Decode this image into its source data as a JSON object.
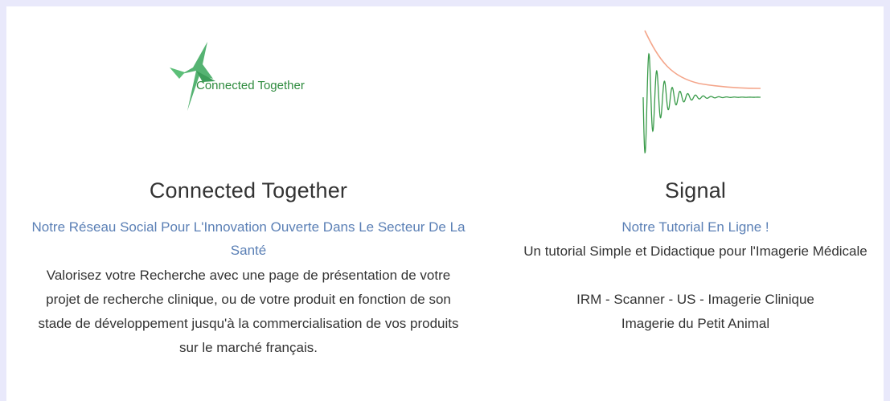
{
  "cards": [
    {
      "logo_text": "Connected Together",
      "title": "Connected Together",
      "subtitle": "Notre Réseau Social Pour L'Innovation Ouverte Dans Le Secteur De La Santé",
      "description": "Valorisez votre Recherche avec une page de présentation de votre projet de recherche clinique, ou de votre produit en fonction de son stade de développement jusqu'à la commercialisation de vos produits sur le marché français."
    },
    {
      "title": "Signal",
      "subtitle": "Notre Tutorial En Ligne !",
      "description": "Un tutorial Simple et Didactique pour l'Imagerie Médicale\n\nIRM - Scanner - US - Imagerie Clinique\nImagerie du Petit Animal"
    }
  ],
  "colors": {
    "background": "#e9e9fb",
    "panel": "#ffffff",
    "heading": "#333333",
    "subtitle_link": "#5a7fb5",
    "logo_green": "#4caf6a",
    "logo_text_green": "#2e8b3e",
    "signal_green": "#3a9b4a",
    "signal_orange": "#f4a58a"
  }
}
